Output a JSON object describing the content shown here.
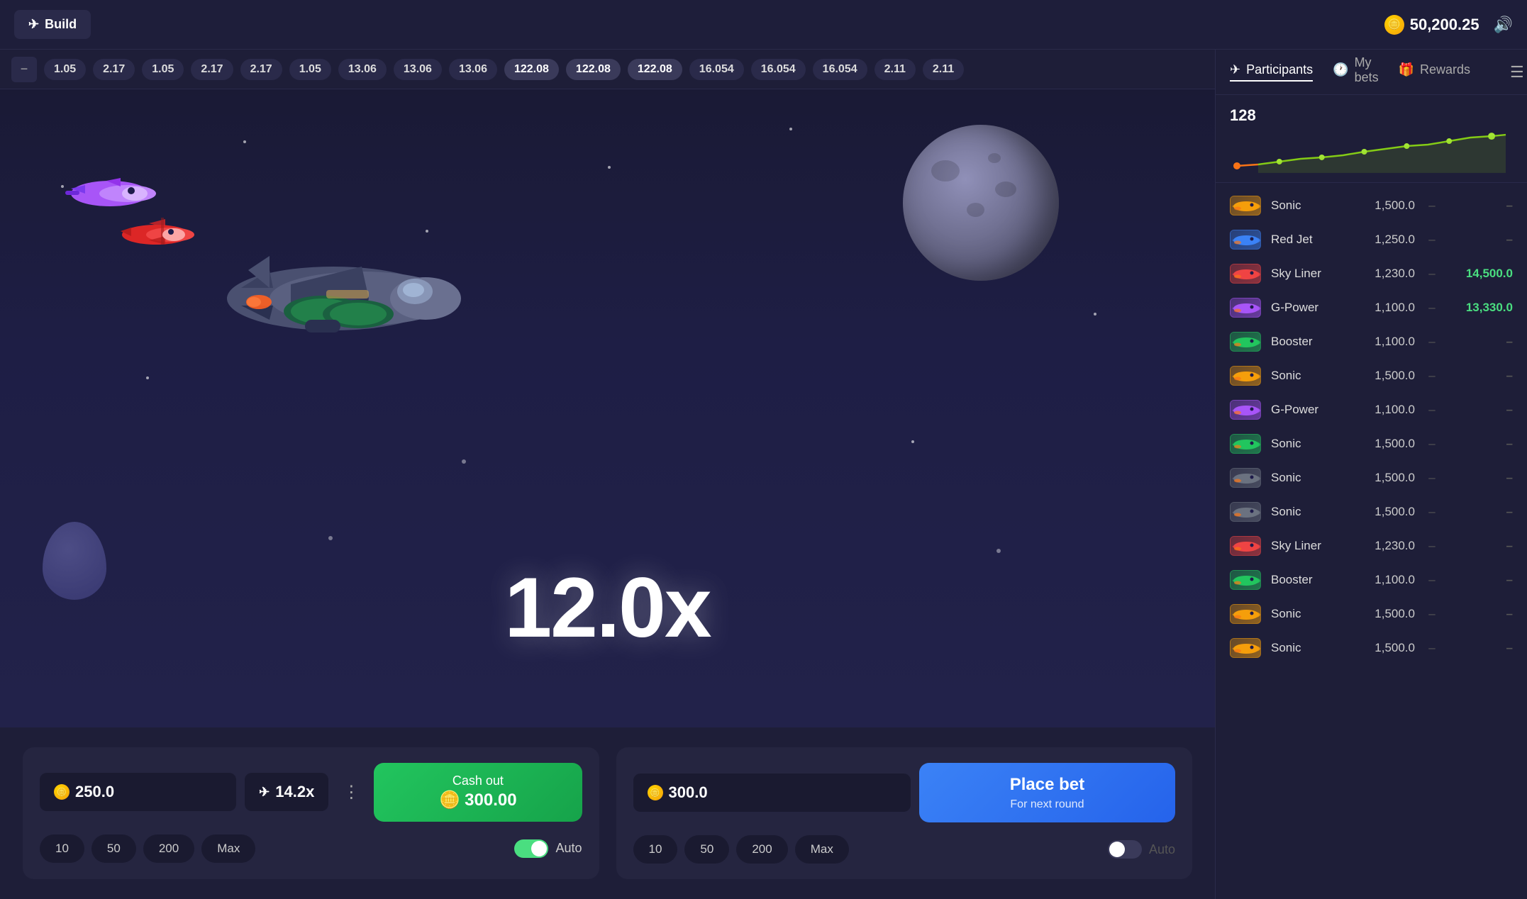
{
  "header": {
    "build_label": "Build",
    "balance": "50,200.25",
    "balance_icon": "🪙"
  },
  "ticker": {
    "items": [
      "1.05",
      "2.17",
      "1.05",
      "2.17",
      "2.17",
      "1.05",
      "13.06",
      "13.06",
      "13.06",
      "122.08",
      "122.08",
      "122.08",
      "16.054",
      "16.054",
      "16.054",
      "2.11",
      "2.11"
    ]
  },
  "game": {
    "multiplier": "12.0x"
  },
  "right_panel": {
    "tabs": [
      {
        "id": "participants",
        "label": "Participants",
        "active": true
      },
      {
        "id": "my_bets",
        "label": "My bets",
        "active": false
      },
      {
        "id": "rewards",
        "label": "Rewards",
        "active": false
      }
    ],
    "chart_count": "128",
    "participants": [
      {
        "name": "Sonic",
        "bet": "1,500.0",
        "win": "–",
        "win_type": "neutral"
      },
      {
        "name": "Red Jet",
        "bet": "1,250.0",
        "win": "–",
        "win_type": "neutral"
      },
      {
        "name": "Sky Liner",
        "bet": "1,230.0",
        "win": "14,500.0",
        "win_type": "positive"
      },
      {
        "name": "G-Power",
        "bet": "1,100.0",
        "win": "13,330.0",
        "win_type": "positive"
      },
      {
        "name": "Booster",
        "bet": "1,100.0",
        "win": "–",
        "win_type": "neutral"
      },
      {
        "name": "Sonic",
        "bet": "1,500.0",
        "win": "–",
        "win_type": "neutral"
      },
      {
        "name": "G-Power",
        "bet": "1,100.0",
        "win": "–",
        "win_type": "neutral"
      },
      {
        "name": "Sonic",
        "bet": "1,500.0",
        "win": "–",
        "win_type": "neutral"
      },
      {
        "name": "Sonic",
        "bet": "1,500.0",
        "win": "–",
        "win_type": "neutral"
      },
      {
        "name": "Sonic",
        "bet": "1,500.0",
        "win": "–",
        "win_type": "neutral"
      },
      {
        "name": "Sky Liner",
        "bet": "1,230.0",
        "win": "–",
        "win_type": "neutral"
      },
      {
        "name": "Booster",
        "bet": "1,100.0",
        "win": "–",
        "win_type": "neutral"
      },
      {
        "name": "Sonic",
        "bet": "1,500.0",
        "win": "–",
        "win_type": "neutral"
      },
      {
        "name": "Sonic",
        "bet": "1,500.0",
        "win": "–",
        "win_type": "neutral"
      }
    ]
  },
  "bet_panel_1": {
    "amount": "250.0",
    "multiplier": "14.2x",
    "cashout_label": "Cash out",
    "cashout_amount": "300.00",
    "quick_amounts": [
      "10",
      "50",
      "200",
      "Max"
    ],
    "auto_label": "Auto",
    "auto_active": true
  },
  "bet_panel_2": {
    "amount": "300.0",
    "place_bet_label": "Place bet",
    "place_bet_sub": "For next round",
    "quick_amounts": [
      "10",
      "50",
      "200",
      "Max"
    ],
    "auto_label": "Auto",
    "auto_active": false
  },
  "plane_colors": {
    "main": "#5a6080",
    "small1": "#c060d0",
    "small2": "#cc4444"
  }
}
